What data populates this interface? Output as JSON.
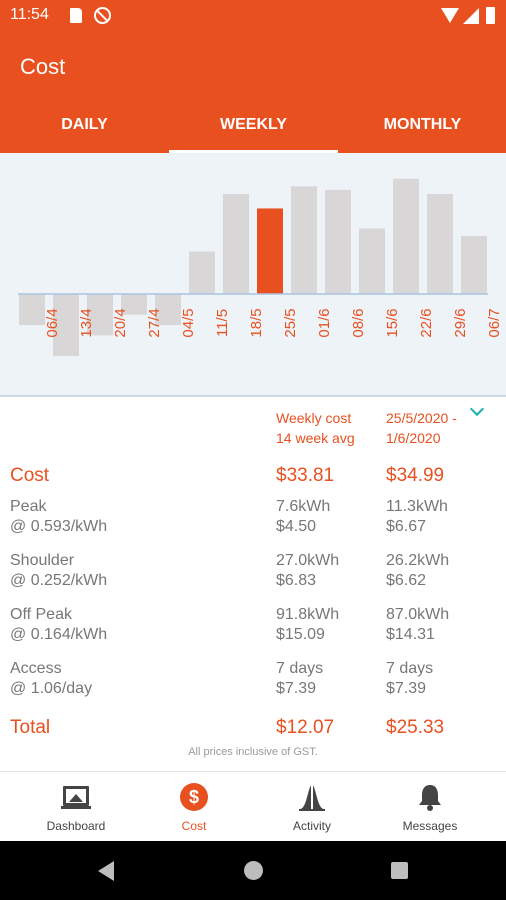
{
  "status_bar": {
    "time": "11:54"
  },
  "app_bar": {
    "title": "Cost"
  },
  "tabs": [
    {
      "label": "DAILY",
      "active": false
    },
    {
      "label": "WEEKLY",
      "active": true
    },
    {
      "label": "MONTHLY",
      "active": false
    }
  ],
  "colors": {
    "accent": "#e8501f",
    "bar_default": "#d8d6d6",
    "bar_selected": "#e8501f",
    "chevron": "#1ab0b0"
  },
  "chart_data": {
    "type": "bar",
    "categories": [
      "06/4",
      "13/4",
      "20/4",
      "27/4",
      "04/5",
      "11/5",
      "18/5",
      "25/5",
      "01/6",
      "08/6",
      "15/6",
      "22/6",
      "29/6",
      "06/7"
    ],
    "values": [
      -4.5,
      -9,
      -6,
      -3,
      -4.5,
      6.15,
      14.5,
      12.4,
      15.6,
      15.1,
      9.5,
      16.7,
      14.5,
      8.4
    ],
    "selected_category": "25/5",
    "ylim": [
      -10,
      18
    ]
  },
  "table": {
    "header": {
      "col1_line1": "Weekly cost",
      "col1_line2": "14 week avg",
      "col2_line1": "25/5/2020 -",
      "col2_line2": "1/6/2020"
    },
    "cost": {
      "label": "Cost",
      "col1": "$33.81",
      "col2": "$34.99"
    },
    "rows": [
      {
        "label": "Peak",
        "rate": "@ 0.593/kWh",
        "col1_usage": "7.6kWh",
        "col1_cost": "$4.50",
        "col2_usage": "11.3kWh",
        "col2_cost": "$6.67"
      },
      {
        "label": "Shoulder",
        "rate": "@ 0.252/kWh",
        "col1_usage": "27.0kWh",
        "col1_cost": "$6.83",
        "col2_usage": "26.2kWh",
        "col2_cost": "$6.62"
      },
      {
        "label": "Off Peak",
        "rate": "@ 0.164/kWh",
        "col1_usage": "91.8kWh",
        "col1_cost": "$15.09",
        "col2_usage": "87.0kWh",
        "col2_cost": "$14.31"
      },
      {
        "label": "Access",
        "rate": "@ 1.06/day",
        "col1_usage": "7 days",
        "col1_cost": "$7.39",
        "col2_usage": "7 days",
        "col2_cost": "$7.39"
      }
    ],
    "total": {
      "label": "Total",
      "col1": "$12.07",
      "col2": "$25.33"
    },
    "footnote": "All prices inclusive of GST."
  },
  "bottom_nav": [
    {
      "label": "Dashboard",
      "icon": "dashboard-icon",
      "active": false
    },
    {
      "label": "Cost",
      "icon": "dollar-icon",
      "active": true
    },
    {
      "label": "Activity",
      "icon": "activity-icon",
      "active": false
    },
    {
      "label": "Messages",
      "icon": "bell-icon",
      "active": false
    }
  ]
}
